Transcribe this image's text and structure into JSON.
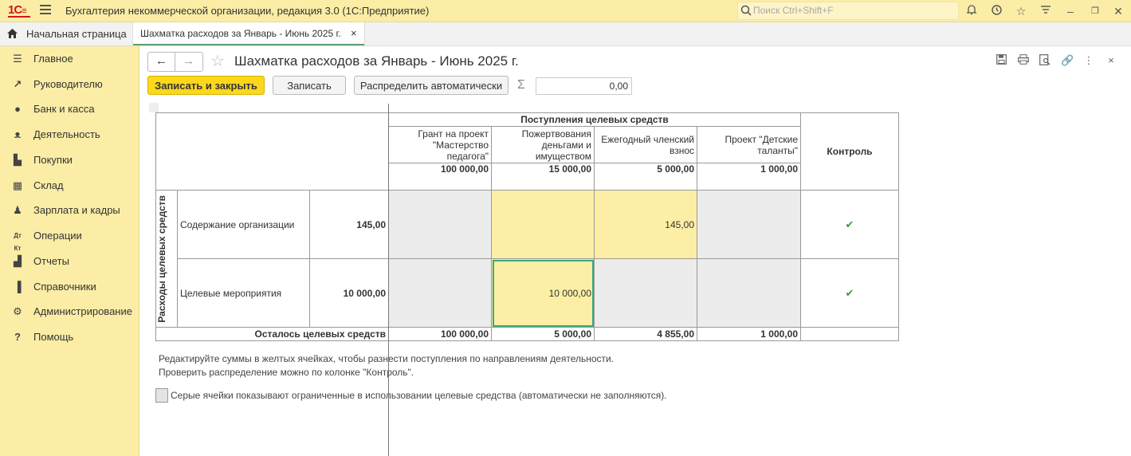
{
  "app": {
    "title": "Бухгалтерия некоммерческой организации, редакция 3.0  (1С:Предприятие)",
    "logo_text": "1С",
    "search_placeholder": "Поиск Ctrl+Shift+F"
  },
  "tabs": {
    "home_label": "Начальная страница",
    "doc_label": "Шахматка расходов за Январь - Июнь 2025 г.",
    "close": "×"
  },
  "sidebar": {
    "items": [
      {
        "label": "Главное",
        "icon": "menu-icon"
      },
      {
        "label": "Руководителю",
        "icon": "trend-icon"
      },
      {
        "label": "Банк и касса",
        "icon": "coins-icon"
      },
      {
        "label": "Деятельность",
        "icon": "activity-icon"
      },
      {
        "label": "Покупки",
        "icon": "cart-icon"
      },
      {
        "label": "Склад",
        "icon": "warehouse-icon"
      },
      {
        "label": "Зарплата и кадры",
        "icon": "person-icon"
      },
      {
        "label": "Операции",
        "icon": "dt-kt-icon"
      },
      {
        "label": "Отчеты",
        "icon": "bar-chart-icon"
      },
      {
        "label": "Справочники",
        "icon": "book-icon"
      },
      {
        "label": "Администрирование",
        "icon": "gear-icon"
      },
      {
        "label": "Помощь",
        "icon": "help-icon"
      }
    ]
  },
  "document": {
    "title": "Шахматка расходов за Январь - Июнь 2025 г.",
    "buttons": {
      "save_close": "Записать и закрыть",
      "save": "Записать",
      "distribute": "Распределить автоматически"
    },
    "sigma": "Σ",
    "sum_value": "0,00"
  },
  "grid": {
    "income_header": "Поступления целевых средств",
    "control_header": "Контроль",
    "expense_header": "Расходы целевых средств",
    "columns": [
      {
        "name": "Грант на проект \"Мастерство педагога\"",
        "total": "100 000,00",
        "remaining": "100 000,00"
      },
      {
        "name": "Пожертвования деньгами и имуществом",
        "total": "15 000,00",
        "remaining": "5 000,00"
      },
      {
        "name": "Ежегодный членский взнос",
        "total": "5 000,00",
        "remaining": "4 855,00"
      },
      {
        "name": "Проект \"Детские таланты\"",
        "total": "1 000,00",
        "remaining": "1 000,00"
      }
    ],
    "rows": [
      {
        "name": "Содержание организации",
        "amount": "145,00",
        "cells": [
          "",
          "",
          "145,00",
          ""
        ],
        "control": "✔"
      },
      {
        "name": "Целевые мероприятия",
        "amount": "10 000,00",
        "cells": [
          "",
          "10 000,00",
          "",
          ""
        ],
        "control": "✔"
      }
    ],
    "remaining_label": "Осталось целевых средств"
  },
  "notes": {
    "line1": "Редактируйте суммы в желтых ячейках, чтобы разнести поступления по направлениям деятельности.",
    "line2": "Проверить распределение можно по колонке \"Контроль\".",
    "legend": "Серые ячейки показывают ограниченные в использовании целевые средства (автоматически не заполняются)."
  }
}
